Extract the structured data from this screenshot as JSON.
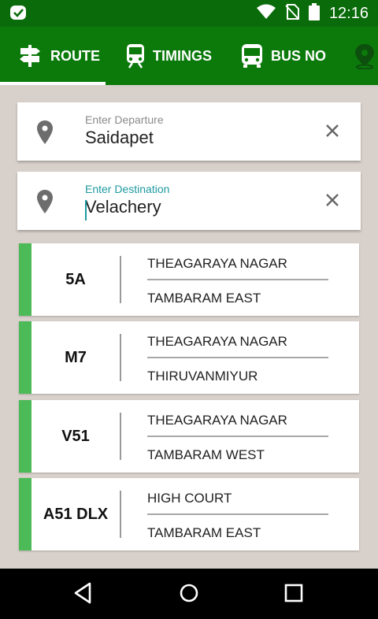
{
  "status_bar": {
    "time": "12:16",
    "icons": [
      "app-check-icon",
      "wifi-icon",
      "no-sim-icon",
      "battery-icon"
    ]
  },
  "tabs": [
    {
      "label": "ROUTE",
      "icon": "signpost-icon",
      "active": true
    },
    {
      "label": "TIMINGS",
      "icon": "train-icon",
      "active": false
    },
    {
      "label": "BUS NO",
      "icon": "bus-icon",
      "active": false
    },
    {
      "label": "",
      "icon": "map-pin-icon",
      "active": false
    }
  ],
  "departure": {
    "label": "Enter Departure",
    "value": "Saidapet"
  },
  "destination": {
    "label": "Enter Destination",
    "value": "Velachery"
  },
  "routes": [
    {
      "number": "5A",
      "from": "THEAGARAYA NAGAR",
      "to": "TAMBARAM EAST"
    },
    {
      "number": "M7",
      "from": "THEAGARAYA NAGAR",
      "to": "THIRUVANMIYUR"
    },
    {
      "number": "V51",
      "from": "THEAGARAYA NAGAR",
      "to": "TAMBARAM WEST"
    },
    {
      "number": "A51 DLX",
      "from": "HIGH COURT",
      "to": "TAMBARAM EAST"
    }
  ],
  "colors": {
    "header_green": "#0b7a0b",
    "accent_green": "#4cba57",
    "focus_teal": "#1e9aa0",
    "background": "#d8d0ca"
  }
}
